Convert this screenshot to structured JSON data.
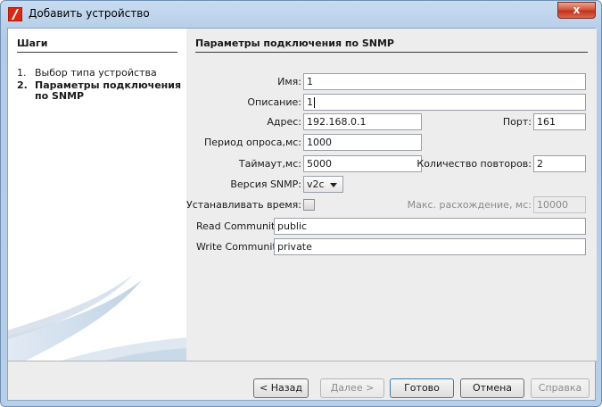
{
  "window": {
    "title": "Добавить устройство",
    "close_label": "x",
    "accent_color": "#c23219"
  },
  "steps": {
    "title": "Шаги",
    "items": [
      {
        "num": "1.",
        "label": "Выбор типа устройства",
        "active": false
      },
      {
        "num": "2.",
        "label": "Параметры подключения по SNMP",
        "active": true
      }
    ]
  },
  "form": {
    "title": "Параметры подключения по SNMP",
    "name_label": "Имя:",
    "name_value": "1",
    "description_label": "Описание:",
    "description_value": "1",
    "address_label": "Адрес:",
    "address_value": "192.168.0.1",
    "port_label": "Порт:",
    "port_value": "161",
    "poll_label": "Период опроса,мс:",
    "poll_value": "1000",
    "timeout_label": "Таймаут,мс:",
    "timeout_value": "5000",
    "retries_label": "Количество повторов:",
    "retries_value": "2",
    "snmp_version_label": "Версия SNMP:",
    "snmp_version_value": "v2c",
    "set_time_label": "Устанавливать время:",
    "set_time_checked": false,
    "max_drift_label": "Макс. расхождение, мс:",
    "max_drift_value": "10000",
    "read_community_label": "Read Community:",
    "read_community_value": "public",
    "write_community_label": "Write Community:",
    "write_community_value": "private"
  },
  "buttons": {
    "back": "< Назад",
    "next": "Далее >",
    "finish": "Готово",
    "cancel": "Отмена",
    "help": "Справка"
  }
}
